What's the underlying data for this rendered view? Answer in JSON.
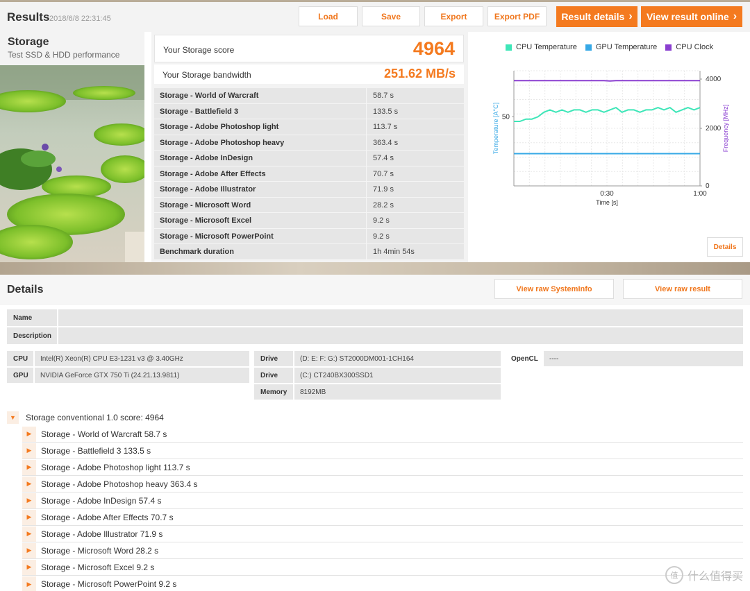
{
  "header": {
    "title": "Results",
    "date": "2018/6/8 22:31:45",
    "buttons": {
      "load": "Load",
      "save": "Save",
      "export": "Export",
      "export_pdf": "Export PDF"
    },
    "result_details": "Result details",
    "view_online": "View result online"
  },
  "storage": {
    "name": "Storage",
    "subtitle": "Test SSD & HDD performance"
  },
  "score": {
    "score_label": "Your Storage score",
    "score_value": "4964",
    "bandwidth_label": "Your Storage bandwidth",
    "bandwidth_value": "251.62 MB/s",
    "rows": [
      {
        "k": "Storage - World of Warcraft",
        "v": "58.7 s"
      },
      {
        "k": "Storage - Battlefield 3",
        "v": "133.5 s"
      },
      {
        "k": "Storage - Adobe Photoshop light",
        "v": "113.7 s"
      },
      {
        "k": "Storage - Adobe Photoshop heavy",
        "v": "363.4 s"
      },
      {
        "k": "Storage - Adobe InDesign",
        "v": "57.4 s"
      },
      {
        "k": "Storage - Adobe After Effects",
        "v": "70.7 s"
      },
      {
        "k": "Storage - Adobe Illustrator",
        "v": "71.9 s"
      },
      {
        "k": "Storage - Microsoft Word",
        "v": "28.2 s"
      },
      {
        "k": "Storage - Microsoft Excel",
        "v": "9.2 s"
      },
      {
        "k": "Storage - Microsoft PowerPoint",
        "v": "9.2 s"
      },
      {
        "k": "Benchmark duration",
        "v": "1h 4min 54s"
      }
    ]
  },
  "chart": {
    "details_button": "Details",
    "colors": {
      "cpu_temp": "#3ee6b8",
      "gpu_temp": "#36a8e6",
      "cpu_clock": "#8a3fd0"
    }
  },
  "chart_data": {
    "type": "line",
    "xlabel": "Time [s]",
    "ylabel": "Temperature [A°C]",
    "y2label": "Frequency [MHz]",
    "x_ticks": [
      "0:30",
      "1:00"
    ],
    "xlim": [
      0,
      60
    ],
    "y_ticks": [
      "50"
    ],
    "y2_ticks": [
      "4000",
      "2000",
      "0"
    ],
    "y2lim": [
      0,
      4000
    ],
    "grid": true,
    "legend": "top",
    "series": [
      {
        "name": "CPU Temperature",
        "axis": "left",
        "values": [
          48,
          48,
          49,
          49,
          50,
          52,
          53,
          52,
          53,
          52,
          53,
          53,
          52,
          53,
          53,
          52,
          53,
          54,
          52,
          53,
          53,
          52,
          53,
          53,
          54,
          53,
          54,
          52,
          53,
          54,
          53,
          54
        ]
      },
      {
        "name": "GPU Temperature",
        "axis": "left",
        "values": [
          34,
          34,
          34,
          34,
          34,
          34,
          34,
          34,
          34,
          34,
          34,
          34,
          34,
          34,
          34,
          34,
          34,
          34,
          34,
          34,
          34,
          34,
          34,
          34,
          34,
          34,
          34,
          34,
          34,
          34,
          34,
          34
        ]
      },
      {
        "name": "CPU Clock",
        "axis": "right",
        "values": [
          3800,
          3800,
          3800,
          3800,
          3800,
          3800,
          3800,
          3800,
          3800,
          3800,
          3800,
          3800,
          3800,
          3800,
          3800,
          3800,
          3790,
          3800,
          3800,
          3800,
          3800,
          3800,
          3800,
          3800,
          3800,
          3800,
          3800,
          3800,
          3800,
          3800,
          3800,
          3800
        ]
      }
    ]
  },
  "details": {
    "title": "Details",
    "view_sysinfo": "View raw SystemInfo",
    "view_result": "View raw result",
    "name_label": "Name",
    "description_label": "Description",
    "cpu_label": "CPU",
    "cpu_value": "Intel(R) Xeon(R) CPU E3-1231 v3 @ 3.40GHz",
    "gpu_label": "GPU",
    "gpu_value": "NVIDIA GeForce GTX 750 Ti (24.21.13.9811)",
    "drive_label": "Drive",
    "drive1_value": "(D: E: F: G:) ST2000DM001-1CH164",
    "drive2_value": "(C:) CT240BX300SSD1",
    "memory_label": "Memory",
    "memory_value": "8192MB",
    "opencl_label": "OpenCL",
    "opencl_value": "----"
  },
  "tree": {
    "root": "Storage conventional 1.0 score: 4964",
    "items": [
      "Storage - World of Warcraft 58.7 s",
      "Storage - Battlefield 3 133.5 s",
      "Storage - Adobe Photoshop light 113.7 s",
      "Storage - Adobe Photoshop heavy 363.4 s",
      "Storage - Adobe InDesign 57.4 s",
      "Storage - Adobe After Effects 70.7 s",
      "Storage - Adobe Illustrator 71.9 s",
      "Storage - Microsoft Word 28.2 s",
      "Storage - Microsoft Excel 9.2 s",
      "Storage - Microsoft PowerPoint 9.2 s"
    ]
  },
  "watermark": "什么值得买",
  "watermark_icon": "值"
}
